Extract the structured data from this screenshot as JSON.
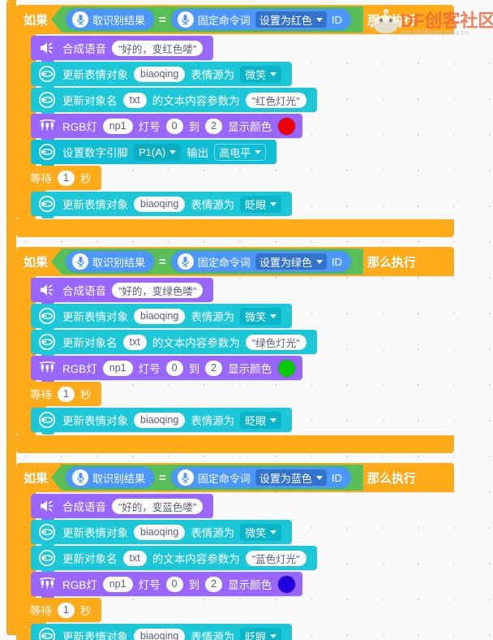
{
  "watermark": {
    "brand": "DF创客社区",
    "url": "mc.DFRobot.com.cn"
  },
  "labels": {
    "if": "如果",
    "then": "那么执行",
    "equals": "=",
    "recognition_result": "取识别结果",
    "fixed_command": "固定命令词",
    "id": "ID",
    "speech_synth": "合成语音",
    "update_emotion_object": "更新表情对象",
    "emotion_source_is": "表情源为",
    "update_object_name": "更新对象名",
    "text_content_param": "的文本内容参数为",
    "rgb_light": "RGB灯",
    "light_no": "灯号",
    "to": "到",
    "show_color": "显示颜色",
    "set_digital_pin": "设置数字引脚",
    "output": "输出",
    "wait": "等待",
    "second": "秒",
    "emotion_object_name": "biaoqing",
    "text_object_name": "txt",
    "rgb_strip_name": "np1",
    "light_from": "0",
    "light_to": "2",
    "wait_value": "1",
    "smile": "微笑",
    "blink": "眨眼"
  },
  "colors": {
    "control": "#ffab19",
    "boolean": "#59c059",
    "reporter": "#4c97ff",
    "reporter_dark": "#3373cc",
    "speech": "#9966ff",
    "display": "#1cc8d8",
    "pin": "#0fbdd5",
    "red": "#ef0000",
    "green": "#00cc00",
    "blue": "#2200dd"
  },
  "blocks": [
    {
      "condition_command": "设置为红色",
      "speech_text": "\"好的，变红色喽\"",
      "text_value": "\"红色灯光\"",
      "swatch_color": "#ef0000",
      "has_pin_block": true,
      "pin_name": "P1(A)",
      "pin_level": "高电平"
    },
    {
      "condition_command": "设置为绿色",
      "speech_text": "\"好的，变绿色喽\"",
      "text_value": "\"绿色灯光\"",
      "swatch_color": "#00cc00",
      "has_pin_block": false,
      "pin_name": "",
      "pin_level": ""
    },
    {
      "condition_command": "设置为蓝色",
      "speech_text": "\"好的，变蓝色喽\"",
      "text_value": "\"蓝色灯光\"",
      "swatch_color": "#2200dd",
      "has_pin_block": false,
      "pin_name": "",
      "pin_level": ""
    }
  ]
}
